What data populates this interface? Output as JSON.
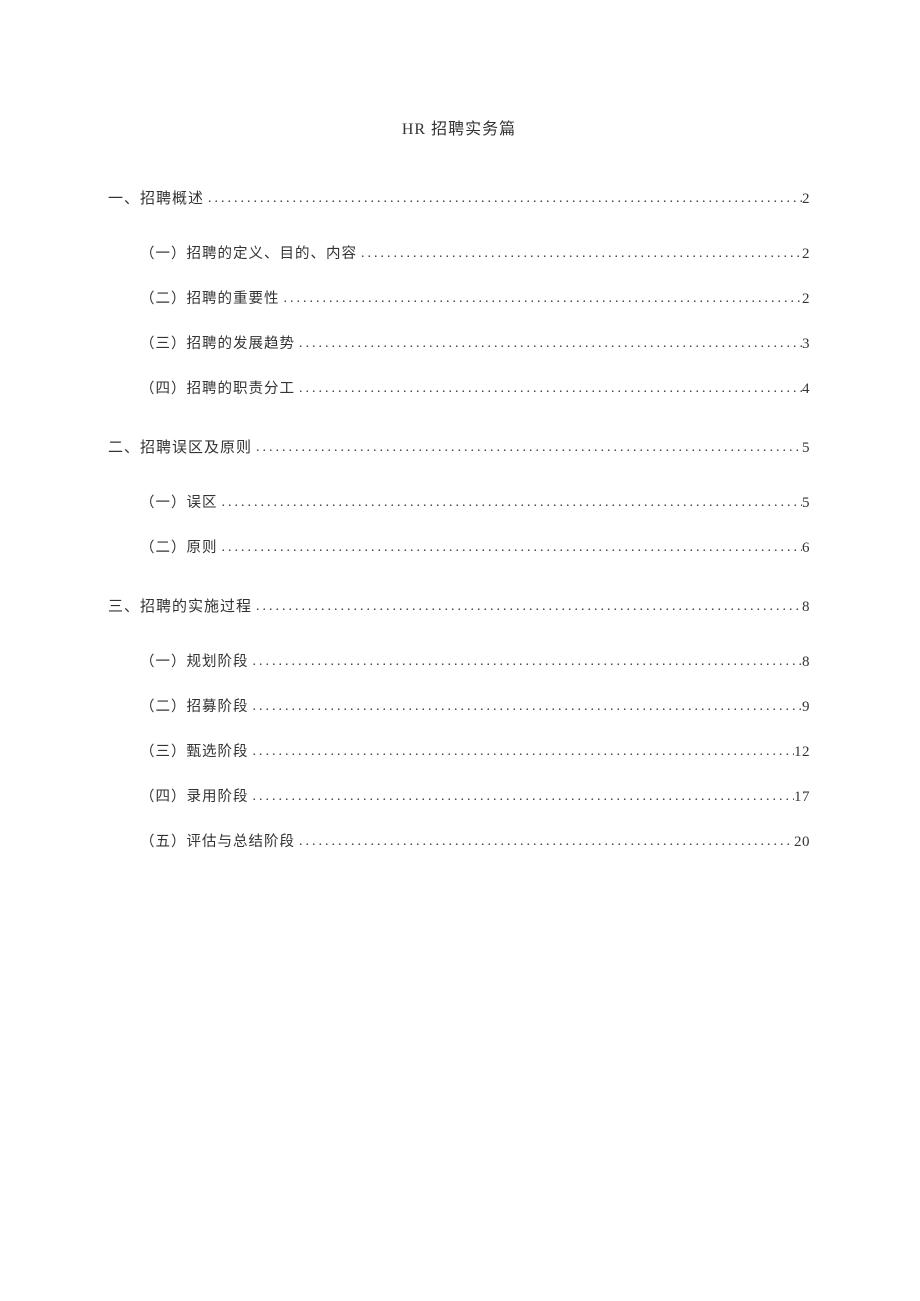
{
  "title": "HR 招聘实务篇",
  "toc": [
    {
      "label": "一、招聘概述",
      "page": "2",
      "children": [
        {
          "label": "（一）招聘的定义、目的、内容",
          "page": "2"
        },
        {
          "label": "（二）招聘的重要性",
          "page": "2"
        },
        {
          "label": "（三）招聘的发展趋势",
          "page": "3"
        },
        {
          "label": "（四）招聘的职责分工",
          "page": "4"
        }
      ]
    },
    {
      "label": "二、招聘误区及原则",
      "page": "5",
      "children": [
        {
          "label": "（一）误区",
          "page": "5"
        },
        {
          "label": "（二）原则",
          "page": "6"
        }
      ]
    },
    {
      "label": "三、招聘的实施过程",
      "page": "8",
      "children": [
        {
          "label": "（一）规划阶段",
          "page": "8"
        },
        {
          "label": "（二）招募阶段",
          "page": "9"
        },
        {
          "label": "（三）甄选阶段",
          "page": "12"
        },
        {
          "label": "（四）录用阶段",
          "page": "17"
        },
        {
          "label": "（五）评估与总结阶段",
          "page": "20"
        }
      ]
    }
  ]
}
